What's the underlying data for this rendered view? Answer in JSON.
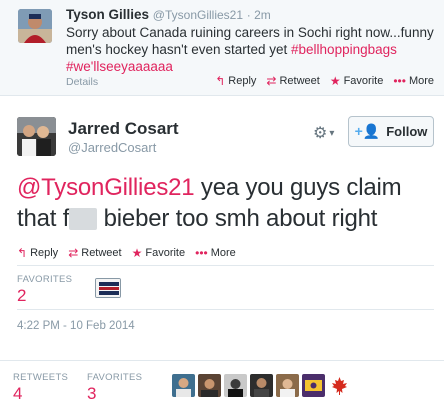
{
  "parent_tweet": {
    "name": "Tyson Gillies",
    "handle": "@TysonGillies21",
    "time": "· 2m",
    "text_main": "Sorry about Canada ruining careers in Sochi right now...funny men's hockey hasn't even started yet ",
    "hashtag1": "#bellhoppingbags",
    "hashtag2": "#we'llseeyaaaaaa",
    "details_label": "Details",
    "actions": {
      "reply": "Reply",
      "retweet": "Retweet",
      "favorite": "Favorite",
      "more": "More"
    }
  },
  "main_tweet": {
    "name": "Jarred Cosart",
    "handle": "@JarredCosart",
    "follow_label": "Follow",
    "mention": "@TysonGillies21",
    "text_part1": " yea you guys claim that f",
    "text_part2": " bieber too smh about right",
    "actions": {
      "reply": "Reply",
      "retweet": "Retweet",
      "favorite": "Favorite",
      "more": "More"
    },
    "favorites_label": "FAVORITES",
    "favorites_count": "2",
    "timestamp": "4:22 PM - 10 Feb 2014"
  },
  "footer": {
    "retweets_label": "RETWEETS",
    "retweets_count": "4",
    "favorites_label": "FAVORITES",
    "favorites_count": "3"
  },
  "colors": {
    "accent": "#e0245e",
    "link_blue": "#55acee",
    "muted": "#8899a6"
  },
  "icons": [
    "reply-icon",
    "retweet-icon",
    "favorite-star-icon",
    "more-dots-icon",
    "gear-icon",
    "chevron-down-icon",
    "follow-person-icon"
  ]
}
